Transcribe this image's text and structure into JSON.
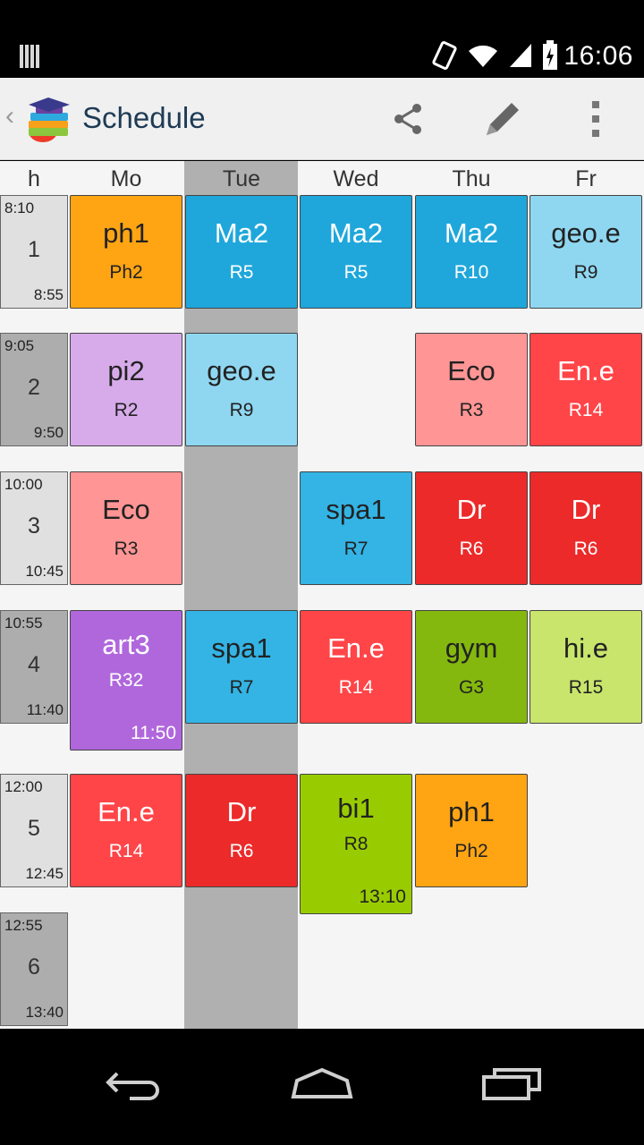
{
  "status_bar": {
    "time": "16:06",
    "icons": [
      "notification-icon",
      "vibrate-icon",
      "wifi-icon",
      "signal-icon",
      "battery-charging-icon"
    ]
  },
  "action_bar": {
    "title": "Schedule",
    "back_glyph": "‹",
    "actions": [
      "share-icon",
      "edit-pencil-icon",
      "overflow-menu-icon"
    ]
  },
  "schedule": {
    "hour_header": "h",
    "days": [
      "Mo",
      "Tue",
      "Wed",
      "Thu",
      "Fr"
    ],
    "today": "Tue",
    "periods": [
      {
        "num": "1",
        "start": "8:10",
        "end": "8:55",
        "bg": "#e0e0e0"
      },
      {
        "num": "2",
        "start": "9:05",
        "end": "9:50",
        "bg": "#adadad"
      },
      {
        "num": "3",
        "start": "10:00",
        "end": "10:45",
        "bg": "#e0e0e0"
      },
      {
        "num": "4",
        "start": "10:55",
        "end": "11:40",
        "bg": "#adadad"
      },
      {
        "num": "5",
        "start": "12:00",
        "end": "12:45",
        "bg": "#e0e0e0"
      },
      {
        "num": "6",
        "start": "12:55",
        "end": "13:40",
        "bg": "#adadad"
      }
    ],
    "lessons": [
      {
        "day": 0,
        "period": 0,
        "subject": "ph1",
        "room": "Ph2",
        "color": "#ffa514",
        "text": "#222222"
      },
      {
        "day": 1,
        "period": 0,
        "subject": "Ma2",
        "room": "R5",
        "color": "#1fa7db",
        "text": "#ffffff"
      },
      {
        "day": 2,
        "period": 0,
        "subject": "Ma2",
        "room": "R5",
        "color": "#1fa7db",
        "text": "#ffffff"
      },
      {
        "day": 3,
        "period": 0,
        "subject": "Ma2",
        "room": "R10",
        "color": "#1fa7db",
        "text": "#ffffff"
      },
      {
        "day": 4,
        "period": 0,
        "subject": "geo.e",
        "room": "R9",
        "color": "#8fd7f1",
        "text": "#222222"
      },
      {
        "day": 0,
        "period": 1,
        "subject": "pi2",
        "room": "R2",
        "color": "#d7abea",
        "text": "#222222"
      },
      {
        "day": 1,
        "period": 1,
        "subject": "geo.e",
        "room": "R9",
        "color": "#8fd7f1",
        "text": "#222222"
      },
      {
        "day": 3,
        "period": 1,
        "subject": "Eco",
        "room": "R3",
        "color": "#ff9595",
        "text": "#222222"
      },
      {
        "day": 4,
        "period": 1,
        "subject": "En.e",
        "room": "R14",
        "color": "#ff4548",
        "text": "#ffffff"
      },
      {
        "day": 0,
        "period": 2,
        "subject": "Eco",
        "room": "R3",
        "color": "#ff9595",
        "text": "#222222"
      },
      {
        "day": 2,
        "period": 2,
        "subject": "spa1",
        "room": "R7",
        "color": "#33b4e5",
        "text": "#222222"
      },
      {
        "day": 3,
        "period": 2,
        "subject": "Dr",
        "room": "R6",
        "color": "#ec2a2a",
        "text": "#ffffff"
      },
      {
        "day": 4,
        "period": 2,
        "subject": "Dr",
        "room": "R6",
        "color": "#ec2a2a",
        "text": "#ffffff"
      },
      {
        "day": 0,
        "period": 3,
        "subject": "art3",
        "room": "R32",
        "end": "11:50",
        "color": "#b067dc",
        "text": "#ffffff"
      },
      {
        "day": 1,
        "period": 3,
        "subject": "spa1",
        "room": "R7",
        "color": "#33b4e5",
        "text": "#222222"
      },
      {
        "day": 2,
        "period": 3,
        "subject": "En.e",
        "room": "R14",
        "color": "#ff4548",
        "text": "#ffffff"
      },
      {
        "day": 3,
        "period": 3,
        "subject": "gym",
        "room": "G3",
        "color": "#84b80e",
        "text": "#222222"
      },
      {
        "day": 4,
        "period": 3,
        "subject": "hi.e",
        "room": "R15",
        "color": "#c9e56c",
        "text": "#222222"
      },
      {
        "day": 0,
        "period": 4,
        "subject": "En.e",
        "room": "R14",
        "color": "#ff4548",
        "text": "#ffffff"
      },
      {
        "day": 1,
        "period": 4,
        "subject": "Dr",
        "room": "R6",
        "color": "#ec2a2a",
        "text": "#ffffff"
      },
      {
        "day": 2,
        "period": 4,
        "subject": "bi1",
        "room": "R8",
        "end": "13:10",
        "color": "#99cc00",
        "text": "#222222"
      },
      {
        "day": 3,
        "period": 4,
        "subject": "ph1",
        "room": "Ph2",
        "color": "#ffa514",
        "text": "#222222"
      }
    ]
  },
  "nav_bar": {
    "buttons": [
      "back-icon",
      "home-icon",
      "recent-apps-icon"
    ]
  }
}
